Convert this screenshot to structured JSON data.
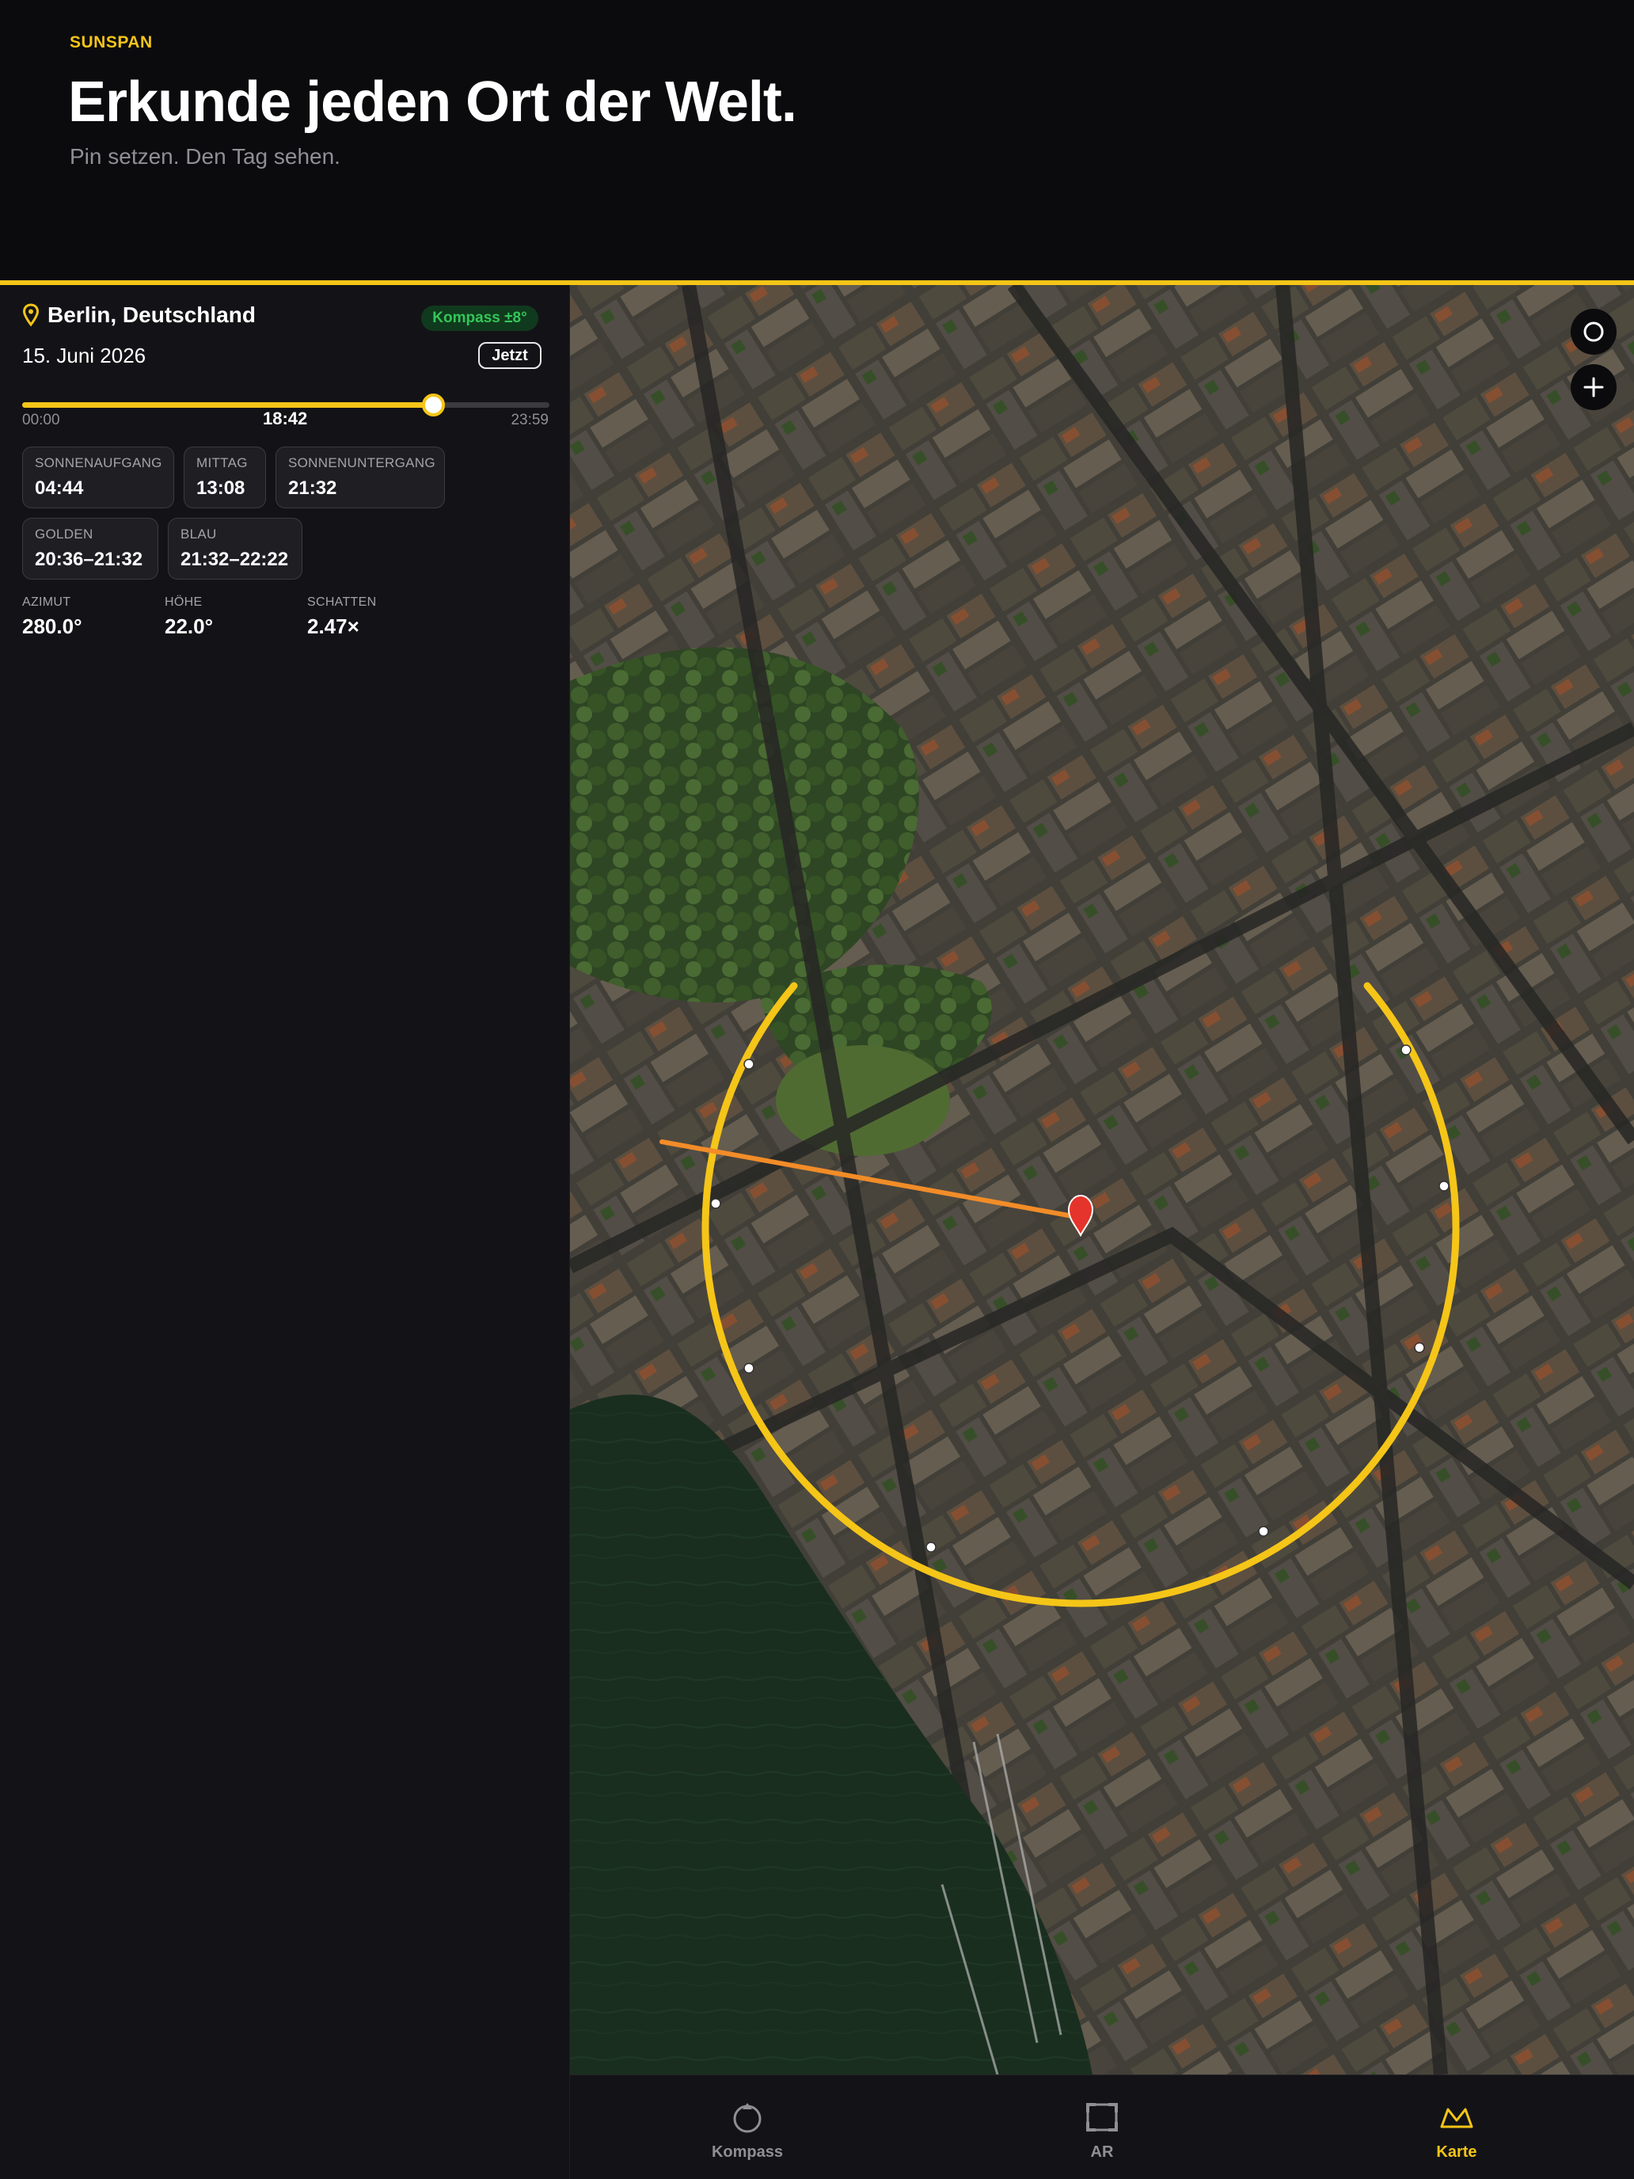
{
  "brand": "SUNSPAN",
  "headline": "Erkunde jeden Ort der Welt.",
  "subline": "Pin setzen. Den Tag sehen.",
  "colors": {
    "accent": "#f5c518",
    "sun_direction": "#f28c28",
    "pin": "#e5342b",
    "compass_ok": "#34c759"
  },
  "panel": {
    "location": "Berlin, Deutschland",
    "location_icon": "map-pin-icon",
    "compass_badge": "Kompass ±8°",
    "date": "15. Juni 2026",
    "now_button": "Jetzt",
    "timeline": {
      "start": "00:00",
      "current": "18:42",
      "end": "23:59",
      "progress": 0.779
    },
    "tiles": [
      {
        "label": "SONNENAUFGANG",
        "value": "04:44"
      },
      {
        "label": "MITTAG",
        "value": "13:08"
      },
      {
        "label": "SONNENUNTERGANG",
        "value": "21:32"
      },
      {
        "label": "GOLDEN",
        "value": "20:36–21:32"
      },
      {
        "label": "BLAU",
        "value": "21:32–22:22"
      }
    ],
    "stats": [
      {
        "label": "AZIMUT",
        "value": "280.0°"
      },
      {
        "label": "HÖHE",
        "value": "22.0°"
      },
      {
        "label": "SCHATTEN",
        "value": "2.47×"
      }
    ]
  },
  "map": {
    "controls": [
      {
        "name": "locate-button",
        "icon": "circle-icon"
      },
      {
        "name": "add-pin-button",
        "icon": "plus-icon"
      }
    ]
  },
  "tabs": [
    {
      "label": "Kompass",
      "icon": "compass-icon",
      "active": false
    },
    {
      "label": "AR",
      "icon": "ar-frame-icon",
      "active": false
    },
    {
      "label": "Karte",
      "icon": "map-icon",
      "active": true
    }
  ]
}
